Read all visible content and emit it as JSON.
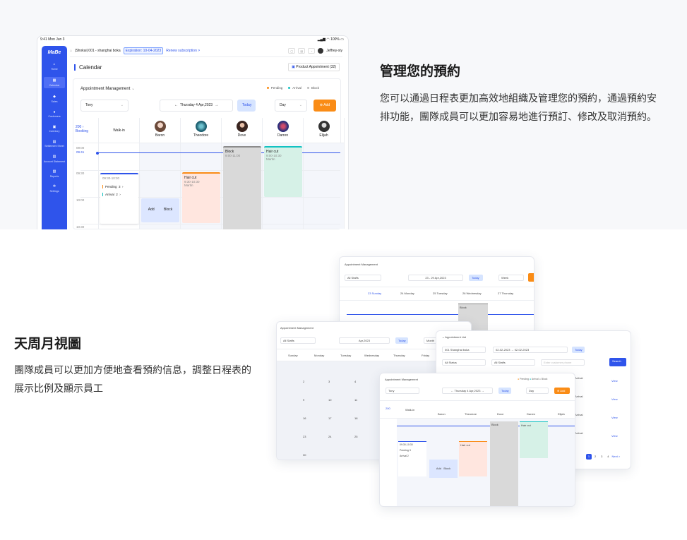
{
  "section1": {
    "title": "管理您的預約",
    "body": "您可以通過日程表更加高效地組織及管理您的預約，通過預約安排功能，團隊成員可以更加容易地進行預訂、修改及取消預約。"
  },
  "section2": {
    "title": "天周月視圖",
    "body": "團隊成員可以更加方便地查看預約信息，調整日程表的展示比例及顯示員工"
  },
  "tablet": {
    "status_time": "9:41  Mon Jun 3",
    "status_right": "100%",
    "logo": "MaBe",
    "nav": [
      "Home",
      "Calendar",
      "Sales",
      "Customers",
      "Inventory",
      "Settlement Sheet",
      "Account Statement",
      "Reports",
      "Settings"
    ],
    "shop": "|Shokai| 001 - shanghai boka",
    "expiration": "Expiration: 10-04-2023",
    "renew": "Renew subscription >",
    "user": "Jeffrey-xiy",
    "page_title": "Calendar",
    "product_btn": "Product Appointment (32)",
    "panel_title": "Appointment Management",
    "legend": {
      "pending": "Pending",
      "arrival": "Arrival",
      "block": "Block"
    },
    "staff_select": "Tony",
    "date": "Thursday 4 Apr,2023",
    "today": "Today",
    "view": "Day",
    "add": "Add",
    "count": "200",
    "booking": "Booking",
    "walkin": "Walk-in",
    "staff": [
      "Baron",
      "Theodore",
      "Dove",
      "Darren",
      "Elijah"
    ],
    "times": [
      "09:00",
      "09:30",
      "10:00",
      "10:30"
    ],
    "now": "09:41",
    "summary_time": "09:30-10:30",
    "pending_label": "Pending",
    "pending_count": "3",
    "arrival_label": "Arrival",
    "arrival_count": "2",
    "add_label": "Add",
    "block_label": "Block",
    "block_event": {
      "title": "Block",
      "time": "9:00-11:00"
    },
    "haircut1": {
      "title": "Hair cut",
      "time": "9:30-10:30",
      "who": "Martin"
    },
    "haircut2": {
      "title": "Hair cut",
      "time": "9:00-10:30",
      "who": "Martin"
    }
  },
  "week": {
    "title": "Appointment Management",
    "staffs": "All Staffs",
    "range": "23 - 29 Apr,2023",
    "today": "Today",
    "view": "Week",
    "days": [
      "23 Sunday",
      "24 Monday",
      "25 Tuesday",
      "26 Wednesday",
      "27 Thursday"
    ],
    "block": "Block"
  },
  "month": {
    "title": "Appointment Management",
    "staffs": "All Staffs",
    "range": "Apr,2023",
    "today": "Today",
    "view": "Month",
    "days": [
      "Sunday",
      "Monday",
      "Tuesday",
      "Wednesday",
      "Thursday",
      "Friday"
    ],
    "dates": [
      "2",
      "3",
      "4",
      "9",
      "10",
      "11",
      "16",
      "17",
      "18",
      "23",
      "24",
      "25",
      "30"
    ]
  },
  "list": {
    "title": "Appointment List",
    "shop": "001 Shanghai boka",
    "from": "02-02-2023",
    "to": "02-02-2023",
    "today": "Today",
    "status": "All Status",
    "staffs": "All Staffs",
    "placeholder": "Enter customer phone",
    "search": "Search",
    "arrival": "Arrival",
    "view": "View",
    "pages": [
      "1",
      "2",
      "3",
      "4"
    ],
    "next": "Next >"
  },
  "colors": {
    "primary": "#2f54eb",
    "pending": "#fa8c16",
    "arrival": "#13c2c2",
    "block": "#8c8c8c"
  }
}
